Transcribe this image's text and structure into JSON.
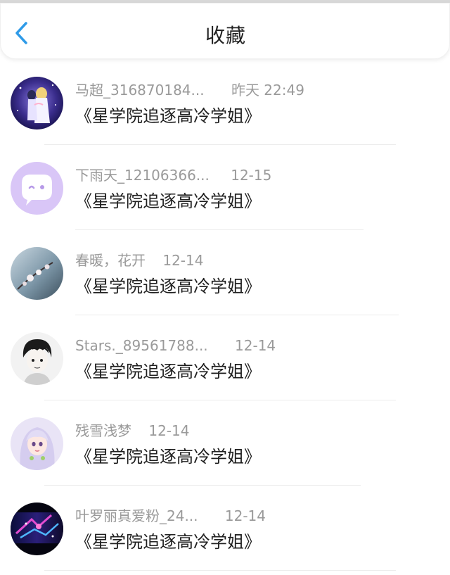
{
  "header": {
    "title": "收藏",
    "back_icon": "chevron-left-icon",
    "accent_color": "#2f9be8"
  },
  "items": [
    {
      "name": "马超_316870184...",
      "time": "昨天 22:49",
      "title": "《星学院追逐高冷学姐》",
      "avatar": "anime-couple-avatar"
    },
    {
      "name": "下雨天_12106366...",
      "time": "12-15",
      "title": "《星学院追逐高冷学姐》",
      "avatar": "default-chat-avatar"
    },
    {
      "name": "春暖，花开",
      "time": "12-14",
      "title": "《星学院追逐高冷学姐》",
      "avatar": "flower-photo-avatar"
    },
    {
      "name": "Stars._89561788...",
      "time": "12-14",
      "title": "《星学院追逐高冷学姐》",
      "avatar": "sketch-boy-avatar"
    },
    {
      "name": "残雪浅梦",
      "time": "12-14",
      "title": "《星学院追逐高冷学姐》",
      "avatar": "doll-girl-avatar"
    },
    {
      "name": "叶罗丽真爱粉_24...",
      "time": "12-14",
      "title": "《星学院追逐高冷学姐》",
      "avatar": "fantasy-scene-avatar"
    }
  ]
}
